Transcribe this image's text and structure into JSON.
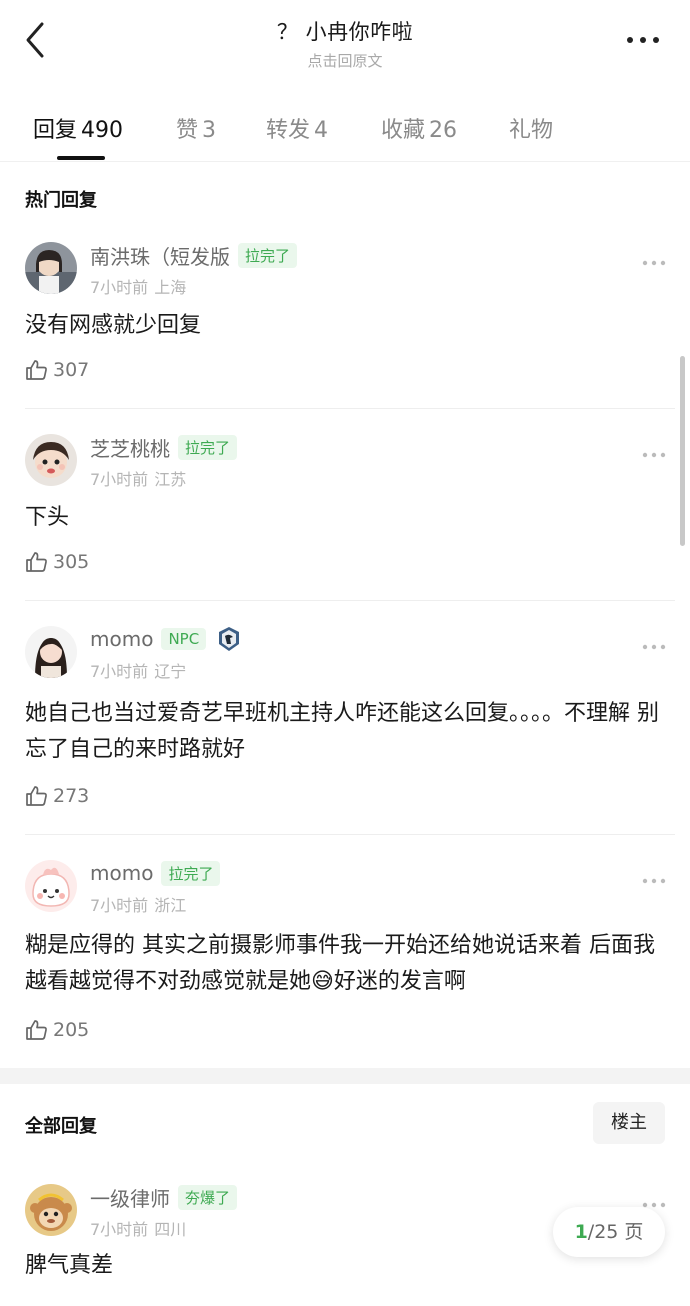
{
  "header": {
    "title": "？ 小冉你咋啦",
    "subtitle": "点击回原文"
  },
  "tabs": [
    {
      "label": "回复",
      "count": "490"
    },
    {
      "label": "赞",
      "count": "3"
    },
    {
      "label": "转发",
      "count": "4"
    },
    {
      "label": "收藏",
      "count": "26"
    },
    {
      "label": "礼物",
      "count": ""
    }
  ],
  "hot_section": {
    "title": "热门回复"
  },
  "hot_comments": [
    {
      "name": "南洪珠（短发版",
      "badge": "拉完了",
      "time": "7小时前",
      "location": "上海",
      "text": "没有网感就少回复",
      "likes": "307"
    },
    {
      "name": "芝芝桃桃",
      "badge": "拉完了",
      "time": "7小时前",
      "location": "江苏",
      "text": "下头",
      "likes": "305"
    },
    {
      "name": "momo",
      "badge": "NPC",
      "time": "7小时前",
      "location": "辽宁",
      "text": "她自己也当过爱奇艺早班机主持人咋还能这么回复。。。。不理解 别忘了自己的来时路就好",
      "likes": "273"
    },
    {
      "name": "momo",
      "badge": "拉完了",
      "time": "7小时前",
      "location": "浙江",
      "text": "糊是应得的 其实之前摄影师事件我一开始还给她说话来着 后面我越看越觉得不对劲感觉就是她😅好迷的发言啊",
      "likes": "205"
    }
  ],
  "all_section": {
    "title": "全部回复",
    "owner_button": "楼主"
  },
  "all_comments": [
    {
      "name": "一级律师",
      "badge": "夯爆了",
      "time": "7小时前",
      "location": "四川",
      "text": "脾气真差"
    }
  ],
  "pagination": {
    "current": "1",
    "total": "/25 页"
  },
  "colors": {
    "accent": "#3eaa52",
    "badge_bg": "#eaf7ec",
    "muted": "#b5b5b5"
  }
}
